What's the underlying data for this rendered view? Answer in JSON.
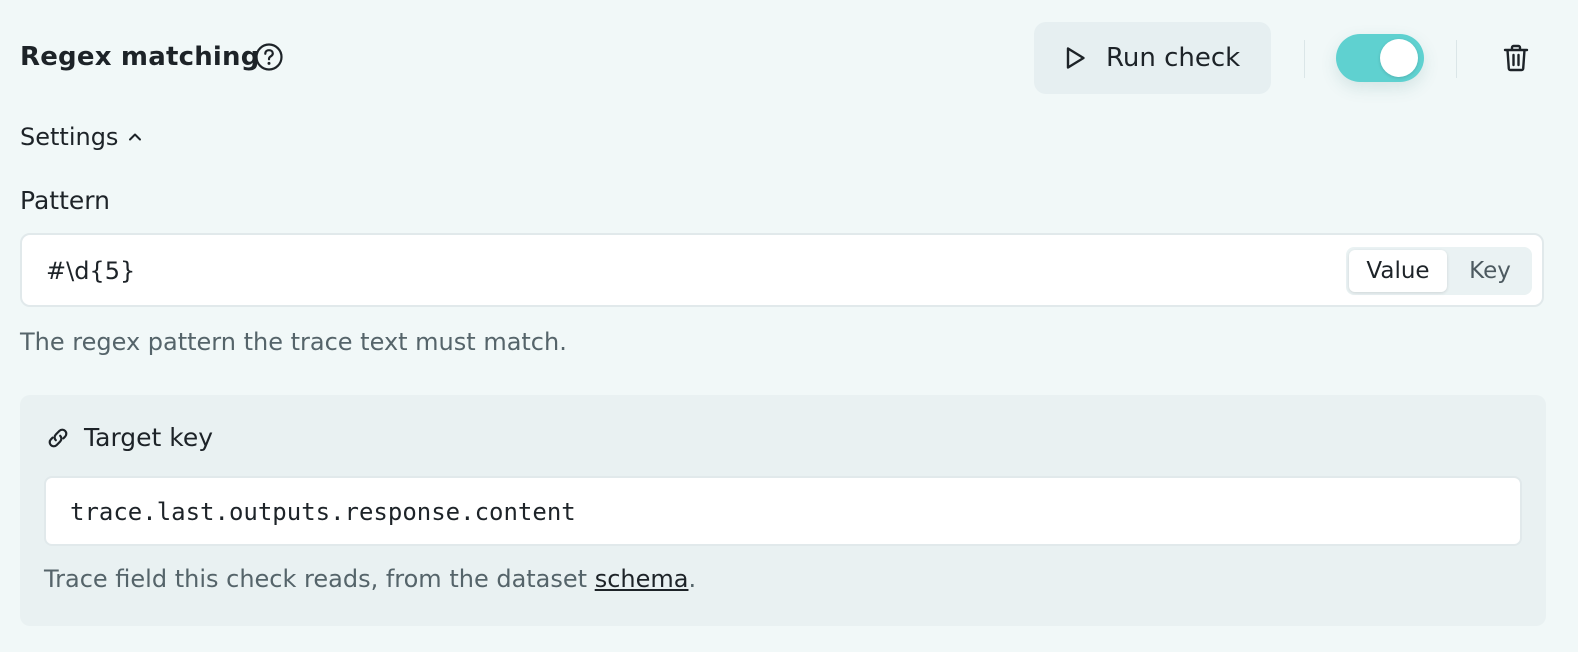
{
  "header": {
    "title": "Regex matching",
    "help_icon": "question-circle-icon",
    "run_button_label": "Run check",
    "run_icon": "play-icon",
    "enabled": true,
    "delete_icon": "trash-icon"
  },
  "settings": {
    "label": "Settings",
    "expanded": true,
    "chevron_icon": "chevron-up-icon"
  },
  "pattern": {
    "label": "Pattern",
    "value": "#\\d{5}",
    "mode_options": [
      "Value",
      "Key"
    ],
    "selected_mode": "Value",
    "help_text": "The regex pattern the trace text must match."
  },
  "target_key": {
    "label": "Target key",
    "icon": "link-icon",
    "value": "trace.last.outputs.response.content",
    "help_prefix": "Trace field this check reads, from the dataset ",
    "help_link": "schema",
    "help_suffix": "."
  },
  "colors": {
    "background": "#f1f8f8",
    "toggle_on": "#5fd1d0",
    "button_bg": "#e6eff1",
    "card_bg": "#e9f1f2",
    "text_primary": "#1d2328",
    "text_muted": "#55646a"
  }
}
